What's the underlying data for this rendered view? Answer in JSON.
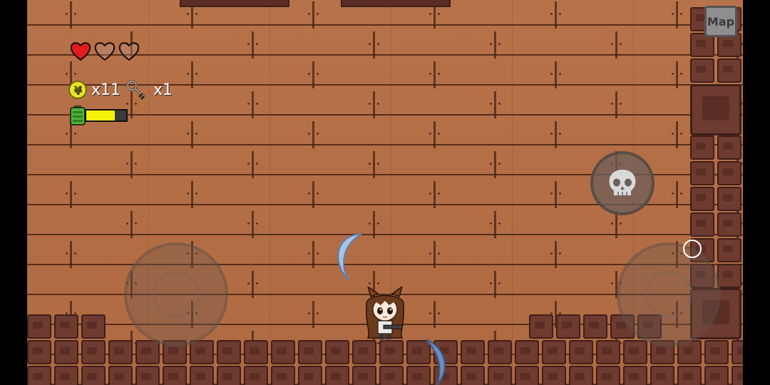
{
  "hud": {
    "hearts": [
      "full",
      "empty",
      "empty"
    ],
    "coin_symbol": "¥",
    "coin_count": "x11",
    "key_count": "x1",
    "energy_fraction": 0.72
  },
  "map_button": {
    "label": "Map"
  },
  "controls": {
    "move_joystick": "joystick-left",
    "aim_joystick": "joystick-right",
    "skill": "skull-icon"
  },
  "colors": {
    "floor": "#b56e45",
    "brick": "#6e3b30",
    "heart": "#e21b1b",
    "coin": "#e7e421",
    "energy": "#f5f20c"
  }
}
